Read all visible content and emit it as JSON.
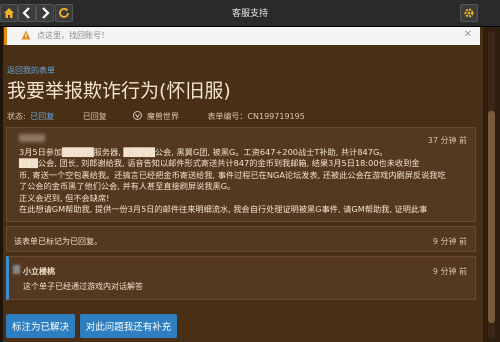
{
  "titlebar": {
    "title": "客服支持",
    "home_icon": "home-icon",
    "back_icon": "chevron-left-icon",
    "forward_icon": "chevron-right-icon",
    "refresh_icon": "refresh-icon",
    "settings_icon": "gear-icon"
  },
  "notice": {
    "text": "点这里，找回账号！",
    "warn_icon": "warning-icon",
    "close_icon": "close-icon"
  },
  "back_link": "返回我的表单",
  "page_title": "我要举报欺诈行为(怀旧服)",
  "status": {
    "label": "状态:",
    "value": "已回复",
    "tag": "已回复",
    "game_icon": "warcraft-icon",
    "game": "魔兽世界",
    "form_number": "表单编号：CN199719195"
  },
  "original_post": {
    "time": "37 分钟 前",
    "lines": [
      "3月5日参加█████服务器, █████公会, 黑翼G团, 被黑G。工资647+200战士T补助, 共计847G。",
      "███公会, 团长, 刘郎谢给我, 语音告知以邮件形式寄送共计847的金币到我邮箱, 结果3月5日18:00也未收到金",
      "币, 寄送一个空包裹给我。还搞言已经把金币寄送给我, 事件过程已在NGA论坛发表, 还被此公会在游戏内刷屏反说我吃",
      "了公会的金币黑了他们公会, 并有人甚至直接刷屏说我黑G。",
      "正义会迟到, 但不会缺席!",
      "在此想请GM帮助我, 提供一份3月5日的邮件往来明细流水, 我会自行处理证明被黑G事件, 请GM帮助我, 证明此事"
    ]
  },
  "system_note": {
    "text": "该表单已标记为已回复。",
    "time": "9 分钟 前"
  },
  "reply": {
    "name": "小立楼桃",
    "text": "这个单子已经通过游戏内对话解答",
    "time": "9 分钟 前"
  },
  "buttons": {
    "resolve": "标注为已解决",
    "supplement": "对此问题我还有补充"
  },
  "colors": {
    "accent": "#2d7fc1",
    "background": "#4a2f17",
    "link": "#5fa8e0",
    "warning": "#e08a1e"
  }
}
